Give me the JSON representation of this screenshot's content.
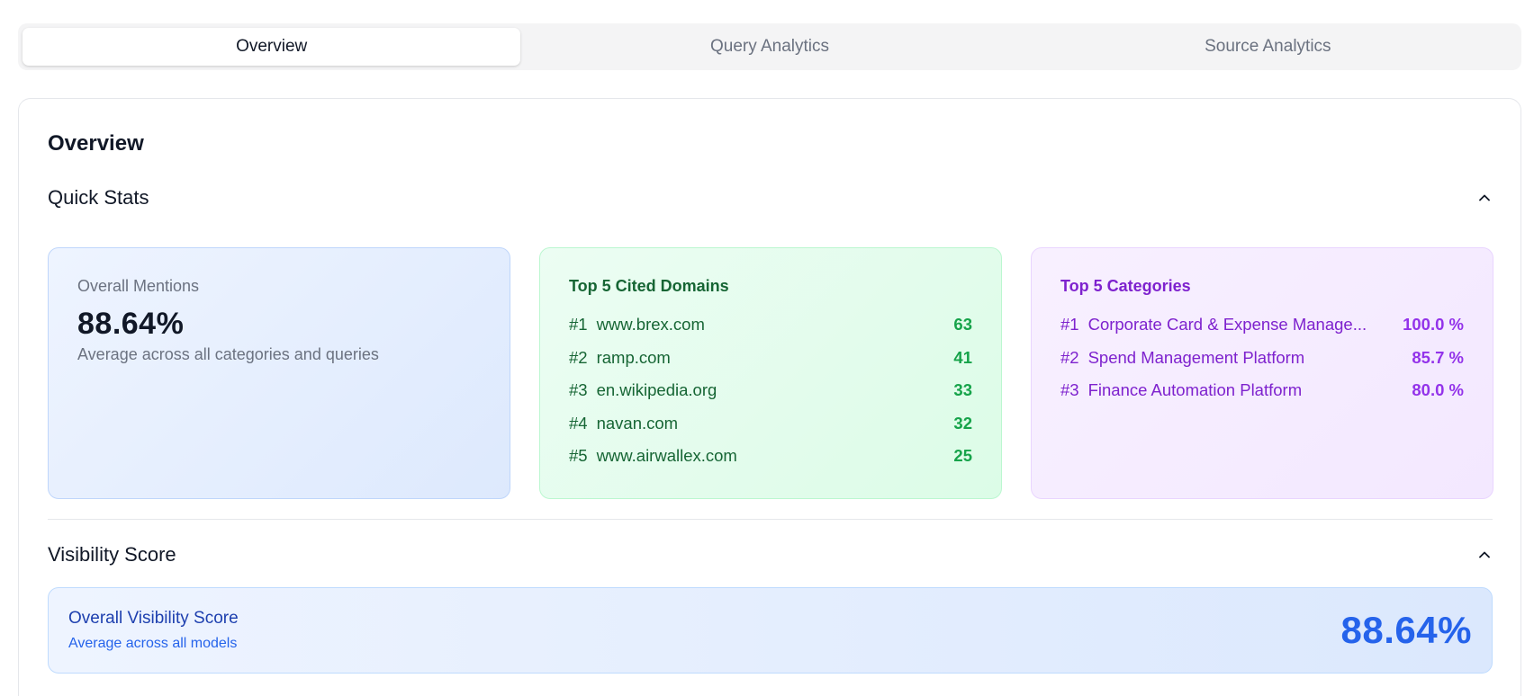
{
  "tabs": [
    {
      "label": "Overview"
    },
    {
      "label": "Query Analytics"
    },
    {
      "label": "Source Analytics"
    }
  ],
  "page_title": "Overview",
  "quick_stats": {
    "title": "Quick Stats",
    "overall_mentions": {
      "label": "Overall Mentions",
      "value": "88.64%",
      "subtitle": "Average across all categories and queries"
    },
    "top_domains": {
      "title": "Top 5 Cited Domains",
      "items": [
        {
          "rank": "#1",
          "name": "www.brex.com",
          "value": "63"
        },
        {
          "rank": "#2",
          "name": "ramp.com",
          "value": "41"
        },
        {
          "rank": "#3",
          "name": "en.wikipedia.org",
          "value": "33"
        },
        {
          "rank": "#4",
          "name": "navan.com",
          "value": "32"
        },
        {
          "rank": "#5",
          "name": "www.airwallex.com",
          "value": "25"
        }
      ]
    },
    "top_categories": {
      "title": "Top 5 Categories",
      "items": [
        {
          "rank": "#1",
          "name": "Corporate Card & Expense Manage...",
          "value": "100.0 %"
        },
        {
          "rank": "#2",
          "name": "Spend Management Platform",
          "value": "85.7 %"
        },
        {
          "rank": "#3",
          "name": "Finance Automation Platform",
          "value": "80.0 %"
        }
      ]
    }
  },
  "visibility": {
    "title": "Visibility Score",
    "box_title": "Overall Visibility Score",
    "box_subtitle": "Average across all models",
    "value": "88.64%"
  },
  "icons": {
    "collapse": "chevron-up-icon"
  },
  "colors": {
    "blue_accent": "#2563eb",
    "green_accent": "#16a34a",
    "purple_accent": "#9333ea"
  }
}
